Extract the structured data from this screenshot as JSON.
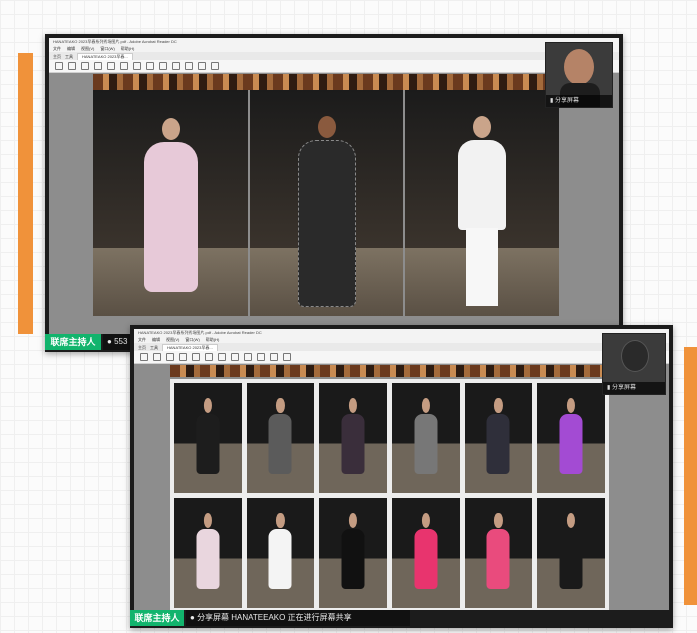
{
  "back_window": {
    "title_bar": "HANATEAKO 2023早春系列秀场图片.pdf - Adobe Acrobat Reader DC",
    "menu": [
      "文件",
      "编辑",
      "视图(V)",
      "窗口(W)",
      "帮助(H)"
    ],
    "tabs": [
      "主页",
      "工具"
    ],
    "doc_tab": "HANATEAKO 2023早春...",
    "host_label": "联席主持人",
    "share_status_prefix": "553",
    "camera_label": "分享屏幕"
  },
  "front_window": {
    "title_bar": "HANATEAKO 2023早春系列秀场图片.pdf - Adobe Acrobat Reader DC",
    "menu": [
      "文件",
      "编辑",
      "视图(V)",
      "窗口(W)",
      "帮助(H)"
    ],
    "tabs": [
      "主页",
      "工具"
    ],
    "doc_tab": "HANATEAKO 2023早春...",
    "host_label": "联席主持人",
    "share_status": "分享屏幕 HANATEEAKO 正在进行屏幕共享",
    "camera_label": "分享屏幕"
  },
  "colors": {
    "accent_orange": "#f0923a",
    "host_green": "#12b46d"
  },
  "looks_large": [
    {
      "dress": "#e7c9d8"
    },
    {
      "dress": "#2a2a2a"
    },
    {
      "dress": "#f2f2f2"
    }
  ],
  "looks_grid": [
    {
      "dress": "#1d1d1d"
    },
    {
      "dress": "#5b5b5b"
    },
    {
      "dress": "#3a2e3b"
    },
    {
      "dress": "#777777"
    },
    {
      "dress": "#2f2f3a"
    },
    {
      "dress": "#a34bd3"
    },
    {
      "dress": "#e9d6de"
    },
    {
      "dress": "#f4f4f4"
    },
    {
      "dress": "#111111"
    },
    {
      "dress": "#e8346e"
    },
    {
      "dress": "#e94b7d"
    },
    {
      "dress": "#1a1a1a"
    }
  ]
}
